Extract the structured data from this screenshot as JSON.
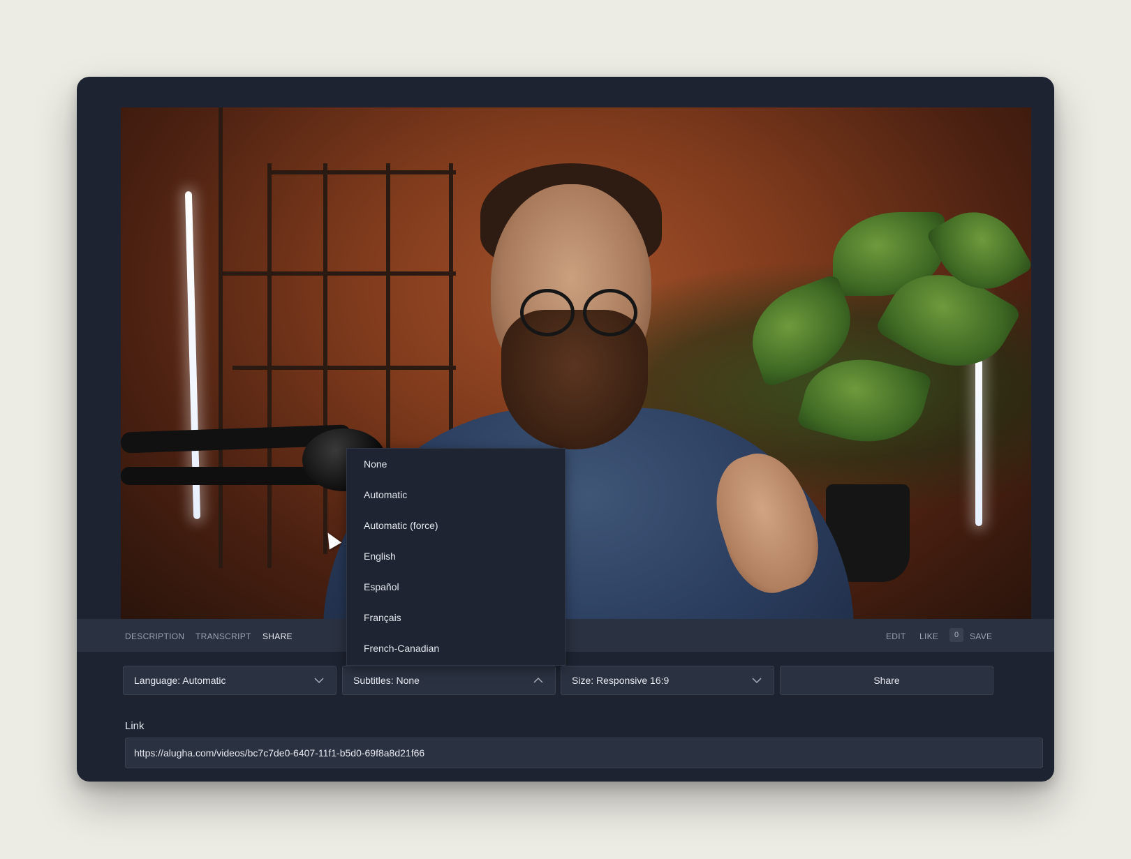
{
  "tabs": {
    "description": "DESCRIPTION",
    "transcript": "TRANSCRIPT",
    "share": "SHARE"
  },
  "actions": {
    "edit": "EDIT",
    "like": "LIKE",
    "like_count": "0",
    "save": "SAVE"
  },
  "controls": {
    "language": "Language: Automatic",
    "subtitles": "Subtitles: None",
    "size": "Size: Responsive 16:9",
    "share": "Share"
  },
  "link": {
    "label": "Link",
    "value": "https://alugha.com/videos/bc7c7de0-6407-11f1-b5d0-69f8a8d21f66"
  },
  "subtitle_options": [
    "None",
    "Automatic",
    "Automatic (force)",
    "English",
    "Español",
    "Français",
    "French-Canadian"
  ],
  "colors": {
    "panel_bg": "#1d2330",
    "control_bg": "#2a3140",
    "text": "#e6e9ef",
    "muted_text": "#9aa3b2",
    "page_bg": "#ecebe4"
  },
  "icons": {
    "dropdown_closed": "chevron-down-icon",
    "dropdown_open": "chevron-up-icon",
    "cursor": "mouse-pointer-icon"
  }
}
